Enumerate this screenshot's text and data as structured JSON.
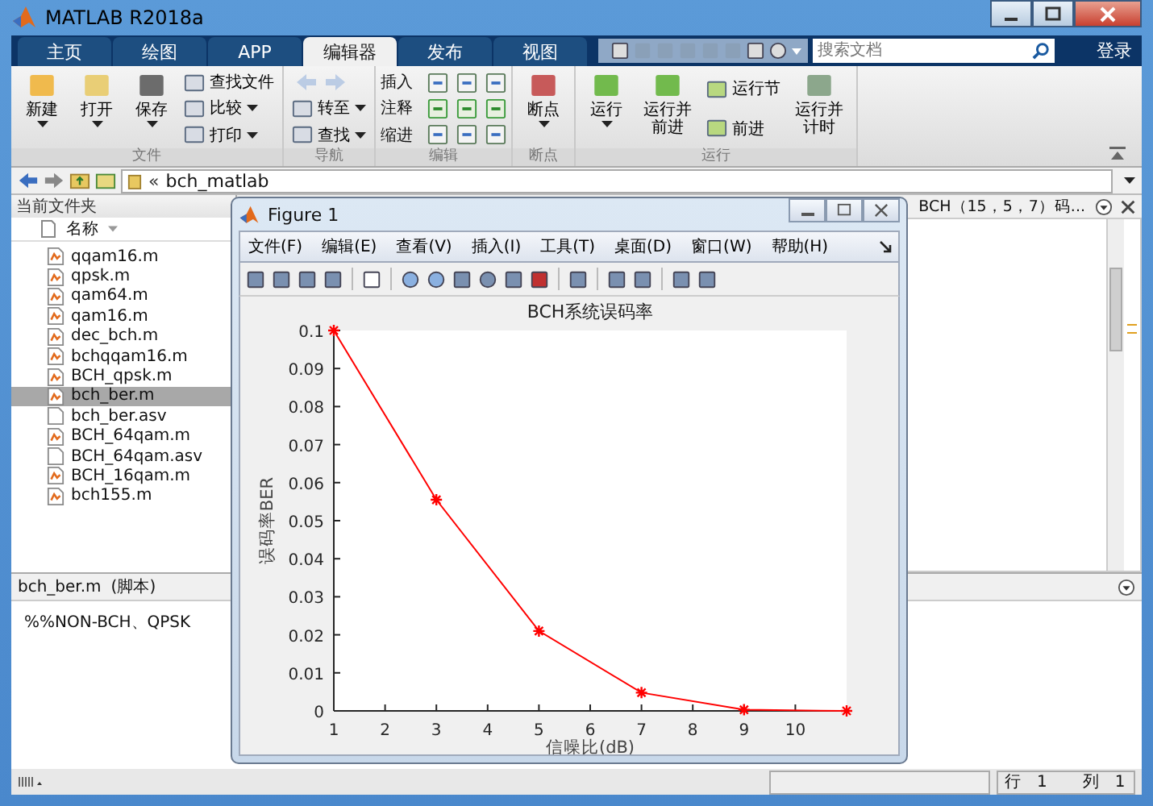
{
  "window": {
    "title": "MATLAB R2018a"
  },
  "tabs": [
    {
      "label": "主页",
      "selected": false
    },
    {
      "label": "绘图",
      "selected": false
    },
    {
      "label": "APP",
      "selected": false
    },
    {
      "label": "编辑器",
      "selected": true
    },
    {
      "label": "发布",
      "selected": false
    },
    {
      "label": "视图",
      "selected": false
    }
  ],
  "search": {
    "placeholder": "搜索文档"
  },
  "sign_in": "登录",
  "ribbon": [
    {
      "title": "文件",
      "items": [
        {
          "kind": "large",
          "label": "新建",
          "dropdown": true
        },
        {
          "kind": "large",
          "label": "打开",
          "dropdown": true
        },
        {
          "kind": "large",
          "label": "保存",
          "dropdown": true
        },
        {
          "kind": "stack",
          "rows": [
            {
              "label": "查找文件",
              "dropdown": false
            },
            {
              "label": "比较",
              "dropdown": true
            },
            {
              "label": "打印",
              "dropdown": true
            }
          ]
        }
      ]
    },
    {
      "title": "导航",
      "items": [
        {
          "kind": "stack",
          "rows": [
            {
              "kind": "arrows",
              "disabled": true
            },
            {
              "label": "转至",
              "dropdown": true
            },
            {
              "label": "查找",
              "dropdown": true
            }
          ]
        }
      ]
    },
    {
      "title": "编辑",
      "items": [
        {
          "kind": "stack",
          "rows": [
            {
              "label": "插入",
              "kind": "tools"
            },
            {
              "label": "注释",
              "kind": "tools"
            },
            {
              "label": "缩进",
              "kind": "tools"
            }
          ]
        }
      ]
    },
    {
      "title": "断点",
      "items": [
        {
          "kind": "large",
          "label": "断点",
          "dropdown": true
        }
      ]
    },
    {
      "title": "运行",
      "items": [
        {
          "kind": "large",
          "label": "运行",
          "dropdown": true
        },
        {
          "kind": "large",
          "label": "运行并前进",
          "dropdown": false
        },
        {
          "kind": "stack",
          "rows": [
            {
              "label": "运行节",
              "dropdown": false
            },
            {
              "label": "前进",
              "dropdown": false
            }
          ]
        },
        {
          "kind": "large",
          "label": "运行并计时",
          "dropdown": false
        }
      ]
    }
  ],
  "path": {
    "separator": "«",
    "folder": "bch_matlab"
  },
  "files_panel": {
    "title": "当前文件夹",
    "column": "名称",
    "files": [
      {
        "name": "qqam16.m",
        "kind": "m",
        "selected": false
      },
      {
        "name": "qpsk.m",
        "kind": "m",
        "selected": false
      },
      {
        "name": "qam64.m",
        "kind": "m",
        "selected": false
      },
      {
        "name": "qam16.m",
        "kind": "m",
        "selected": false
      },
      {
        "name": "dec_bch.m",
        "kind": "m",
        "selected": false
      },
      {
        "name": "bchqqam16.m",
        "kind": "m",
        "selected": false
      },
      {
        "name": "BCH_qpsk.m",
        "kind": "m",
        "selected": false
      },
      {
        "name": "bch_ber.m",
        "kind": "m",
        "selected": true
      },
      {
        "name": "bch_ber.asv",
        "kind": "asv",
        "selected": false
      },
      {
        "name": "BCH_64qam.m",
        "kind": "m",
        "selected": false
      },
      {
        "name": "BCH_64qam.asv",
        "kind": "asv",
        "selected": false
      },
      {
        "name": "BCH_16qam.m",
        "kind": "m",
        "selected": false
      },
      {
        "name": "bch155.m",
        "kind": "m",
        "selected": false
      }
    ]
  },
  "editor": {
    "tab_label": "BCH（15，5，7）码..."
  },
  "details": {
    "title": "bch_ber.m",
    "subtitle": "(脚本)",
    "text": "%%NON-BCH、QPSK"
  },
  "status_bar": {
    "row_label": "行",
    "row": "1",
    "col_label": "列",
    "col": "1"
  },
  "figure": {
    "title": "Figure 1",
    "menu": [
      "文件(F)",
      "编辑(E)",
      "查看(V)",
      "插入(I)",
      "工具(T)",
      "桌面(D)",
      "窗口(W)",
      "帮助(H)"
    ],
    "chart_data": {
      "type": "line",
      "title": "BCH系统误码率",
      "xlabel": "信噪比(dB)",
      "ylabel": "误码率BER",
      "x": [
        1,
        3,
        5,
        7,
        9,
        11
      ],
      "series": [
        {
          "color": "#ff0000",
          "marker": "cross",
          "values": [
            0.1,
            0.0555,
            0.021,
            0.0048,
            0.0003,
            0.0
          ]
        }
      ],
      "xlim": [
        1,
        11
      ],
      "ylim": [
        0,
        0.1
      ],
      "xticks": [
        1,
        2,
        3,
        4,
        5,
        6,
        7,
        8,
        9,
        10
      ],
      "yticks": [
        0,
        0.01,
        0.02,
        0.03,
        0.04,
        0.05,
        0.06,
        0.07,
        0.08,
        0.09,
        0.1
      ]
    }
  }
}
